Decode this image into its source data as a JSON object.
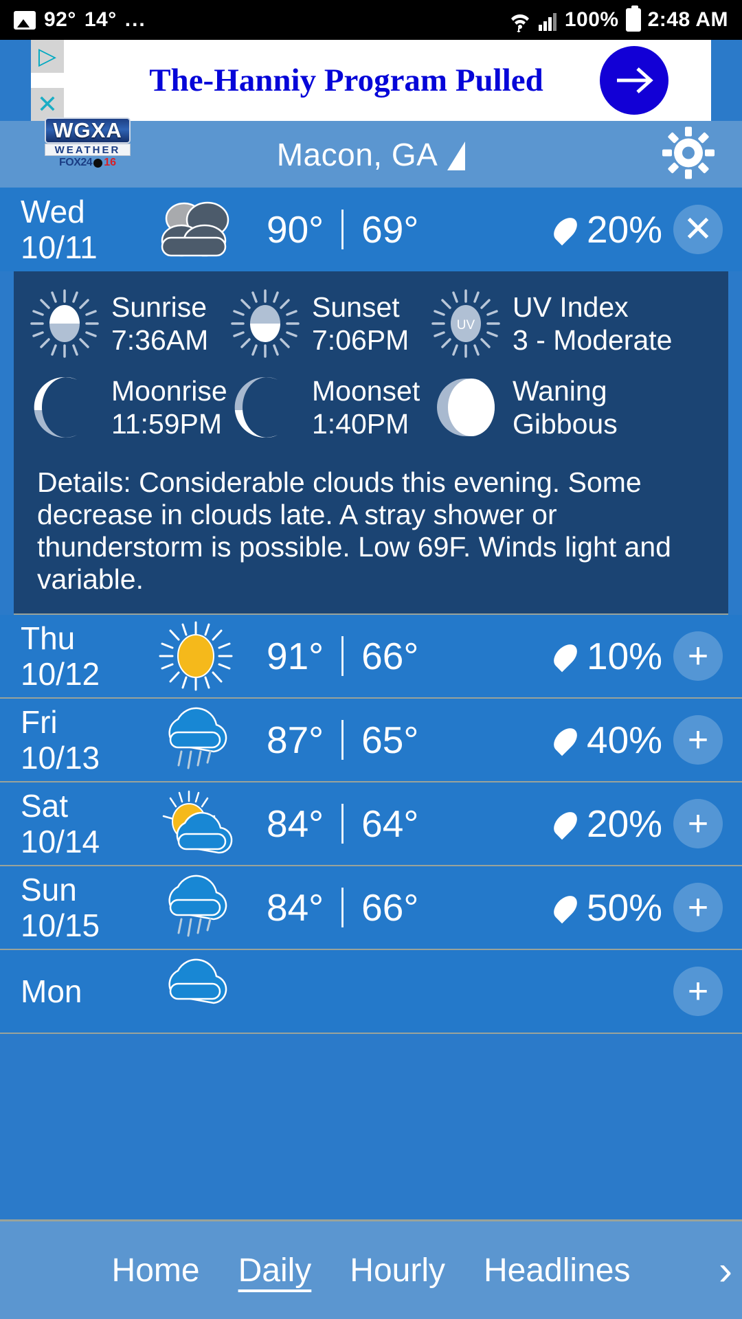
{
  "status_bar": {
    "temp_1": "92°",
    "temp_2": "14°",
    "overflow": "...",
    "battery_percent": "100%",
    "clock": "2:48 AM",
    "icons": [
      "image-icon",
      "wifi-icon",
      "signal-icon",
      "battery-icon"
    ]
  },
  "advertisement": {
    "headline": "The-Hanniy Program Pulled",
    "arrow_glyph": "→",
    "close_glyph": "✕",
    "adchoices_glyph": "▷"
  },
  "app_header": {
    "logo_main": "WGXA",
    "logo_sub": "WEATHER",
    "logo_fox": "FOX24",
    "logo_num": "16",
    "city": "Macon, GA",
    "settings_icon": "gear-icon"
  },
  "bottom_nav": {
    "items": [
      {
        "label": "Home",
        "active": false
      },
      {
        "label": "Daily",
        "active": true
      },
      {
        "label": "Hourly",
        "active": false
      },
      {
        "label": "Headlines",
        "active": false
      }
    ],
    "chevron": "›"
  },
  "forecast": {
    "expanded_index": 0,
    "days": [
      {
        "day": "Wed",
        "date": "10/11",
        "icon": "cloudy-icon",
        "high": "90°",
        "low": "69°",
        "pop": "20%",
        "action": "✕",
        "expanded": true
      },
      {
        "day": "Thu",
        "date": "10/12",
        "icon": "sunny-icon",
        "high": "91°",
        "low": "66°",
        "pop": "10%",
        "action": "+",
        "expanded": false
      },
      {
        "day": "Fri",
        "date": "10/13",
        "icon": "rain-icon",
        "high": "87°",
        "low": "65°",
        "pop": "40%",
        "action": "+",
        "expanded": false
      },
      {
        "day": "Sat",
        "date": "10/14",
        "icon": "partly-sunny-icon",
        "high": "84°",
        "low": "64°",
        "pop": "20%",
        "action": "+",
        "expanded": false
      },
      {
        "day": "Sun",
        "date": "10/15",
        "icon": "rain-icon",
        "high": "84°",
        "low": "66°",
        "pop": "50%",
        "action": "+",
        "expanded": false
      },
      {
        "day": "Mon",
        "date": "",
        "icon": "cloud-icon",
        "high": "",
        "low": "",
        "pop": "",
        "action": "+",
        "expanded": false
      }
    ],
    "detail": {
      "sunrise_label": "Sunrise",
      "sunrise_value": "7:36AM",
      "sunset_label": "Sunset",
      "sunset_value": "7:06PM",
      "uv_label": "UV Index",
      "uv_value": "3 - Moderate",
      "uv_badge": "UV",
      "moonrise_label": "Moonrise",
      "moonrise_value": "11:59PM",
      "moonset_label": "Moonset",
      "moonset_value": "1:40PM",
      "moonphase_line1": "Waning",
      "moonphase_line2": "Gibbous",
      "details_text": "Details: Considerable clouds this evening. Some decrease in clouds late. A stray shower or thunderstorm is possible. Low 69F. Winds light and variable."
    }
  },
  "colors": {
    "row_bg": "#2479ca",
    "header_bg": "#5b96d0",
    "detail_bg": "#1b4473",
    "ad_blue": "#0505d8",
    "sun_yellow": "#f5b91b",
    "cloud_blue": "#1887d4"
  }
}
